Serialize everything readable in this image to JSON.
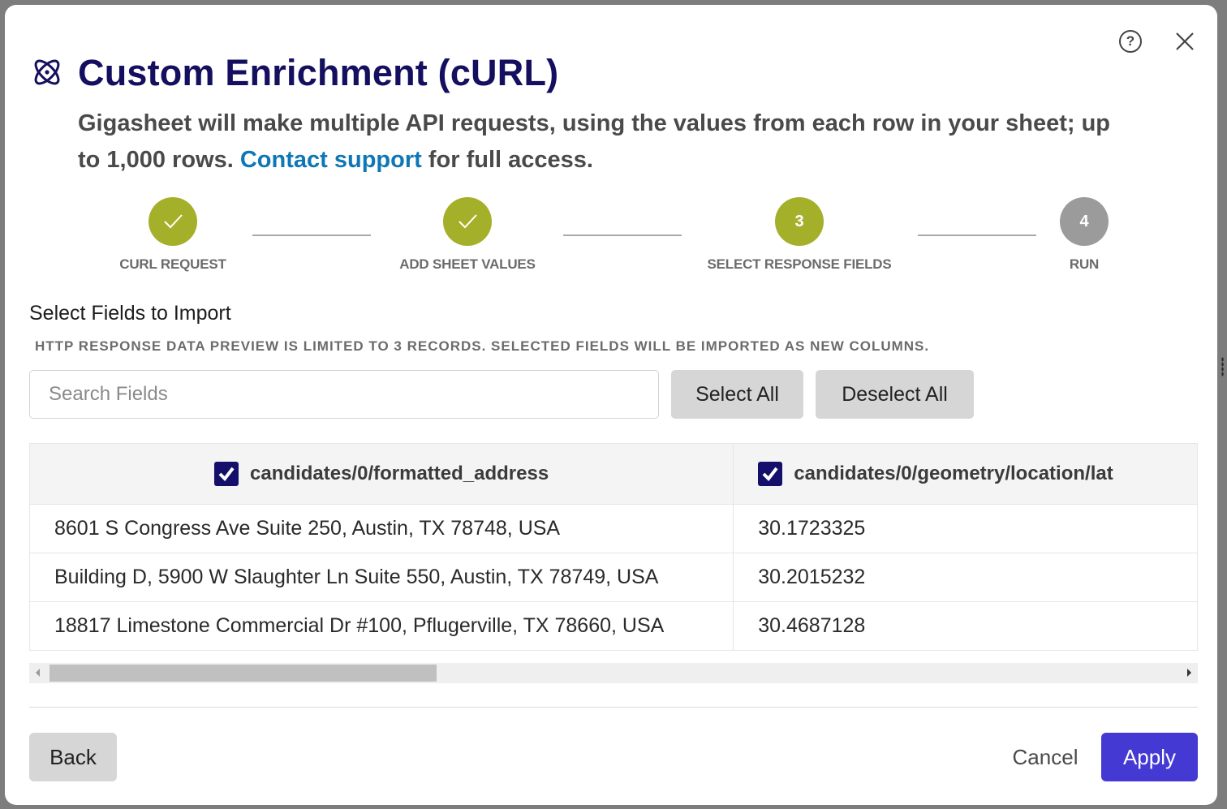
{
  "header": {
    "title": "Custom Enrichment (cURL)",
    "description_prefix": "Gigasheet will make multiple API requests, using the values from each row in your sheet; up to 1,000 rows. ",
    "description_link": "Contact support",
    "description_suffix": " for full access.",
    "help_icon": "help-circle-icon",
    "close_icon": "close-icon",
    "title_icon": "atom-icon"
  },
  "colors": {
    "title": "#140f5e",
    "link": "#0f77b5",
    "step_complete": "#a5b02a",
    "step_pending": "#9b9b9b",
    "checkbox": "#140f6b",
    "primary_button": "#4439d2"
  },
  "stepper": {
    "steps": [
      {
        "label": "CURL REQUEST",
        "status": "complete",
        "marker": "✓"
      },
      {
        "label": "ADD SHEET VALUES",
        "status": "complete",
        "marker": "✓"
      },
      {
        "label": "SELECT RESPONSE FIELDS",
        "status": "active",
        "marker": "3"
      },
      {
        "label": "RUN",
        "status": "pending",
        "marker": "4"
      }
    ]
  },
  "section": {
    "title": "Select Fields to Import",
    "note": "HTTP RESPONSE DATA PREVIEW IS LIMITED TO 3 RECORDS. SELECTED FIELDS WILL BE IMPORTED AS NEW COLUMNS."
  },
  "search": {
    "placeholder": "Search Fields",
    "value": ""
  },
  "buttons": {
    "select_all": "Select All",
    "deselect_all": "Deselect All",
    "back": "Back",
    "cancel": "Cancel",
    "apply": "Apply"
  },
  "table": {
    "columns": [
      {
        "label": "candidates/0/formatted_address",
        "checked": true
      },
      {
        "label": "candidates/0/geometry/location/lat",
        "checked": true
      }
    ],
    "rows": [
      [
        "8601 S Congress Ave Suite 250, Austin, TX 78748, USA",
        "30.1723325"
      ],
      [
        "Building D, 5900 W Slaughter Ln Suite 550, Austin, TX 78749, USA",
        "30.2015232"
      ],
      [
        "18817 Limestone Commercial Dr #100, Pflugerville, TX 78660, USA",
        "30.4687128"
      ]
    ]
  }
}
